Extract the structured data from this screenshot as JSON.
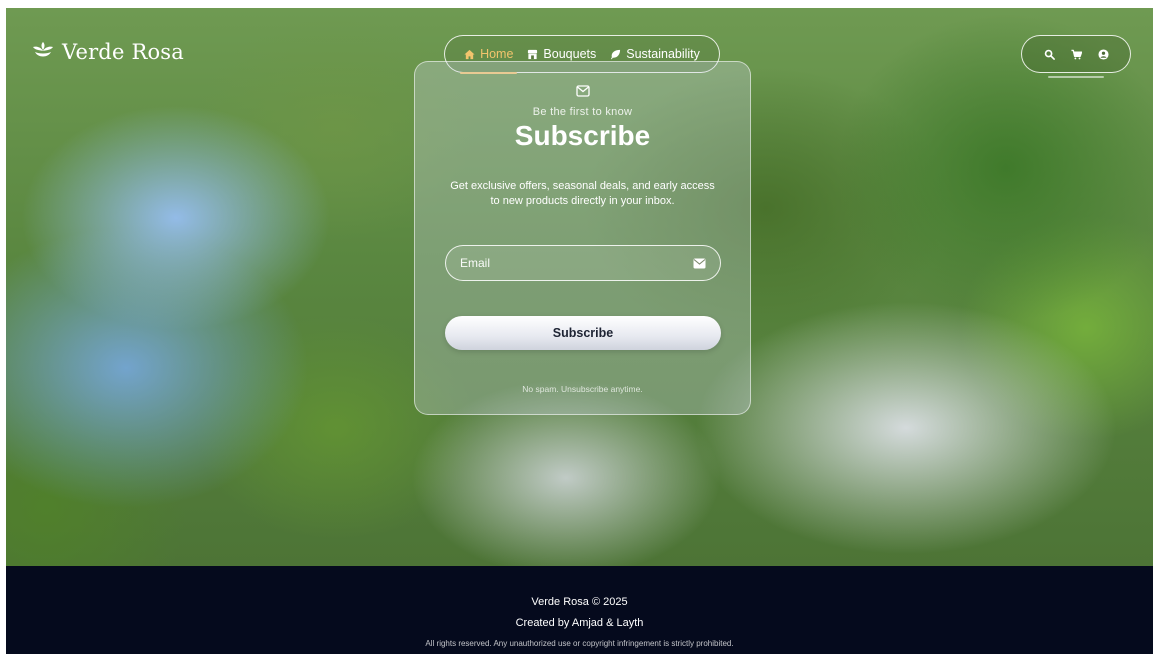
{
  "brand": {
    "name": "Verde Rosa",
    "icon": "leaf-logo-icon"
  },
  "nav": {
    "items": [
      {
        "label": "Home",
        "icon": "home-icon",
        "active": true
      },
      {
        "label": "Bouquets",
        "icon": "store-icon",
        "active": false
      },
      {
        "label": "Sustainability",
        "icon": "leaf-icon",
        "active": false
      }
    ]
  },
  "actions": {
    "icons": [
      "search-icon",
      "cart-icon",
      "user-icon"
    ]
  },
  "subscribe_card": {
    "icon": "envelope-open-icon",
    "eyebrow": "Be the first to know",
    "title": "Subscribe",
    "description": "Get exclusive offers, seasonal deals, and early access to new products directly in your inbox.",
    "email_placeholder": "Email",
    "email_icon": "envelope-icon",
    "button_label": "Subscribe",
    "note": "No spam. Unsubscribe anytime."
  },
  "footer": {
    "line1": "Verde Rosa © 2025",
    "line2": "Created by Amjad & Layth",
    "line3": "All rights reserved. Any unauthorized use or copyright infringement is strictly prohibited."
  },
  "colors": {
    "accent": "#f2c46d",
    "footer_bg": "#050a1d",
    "button_text": "#1d2333"
  }
}
